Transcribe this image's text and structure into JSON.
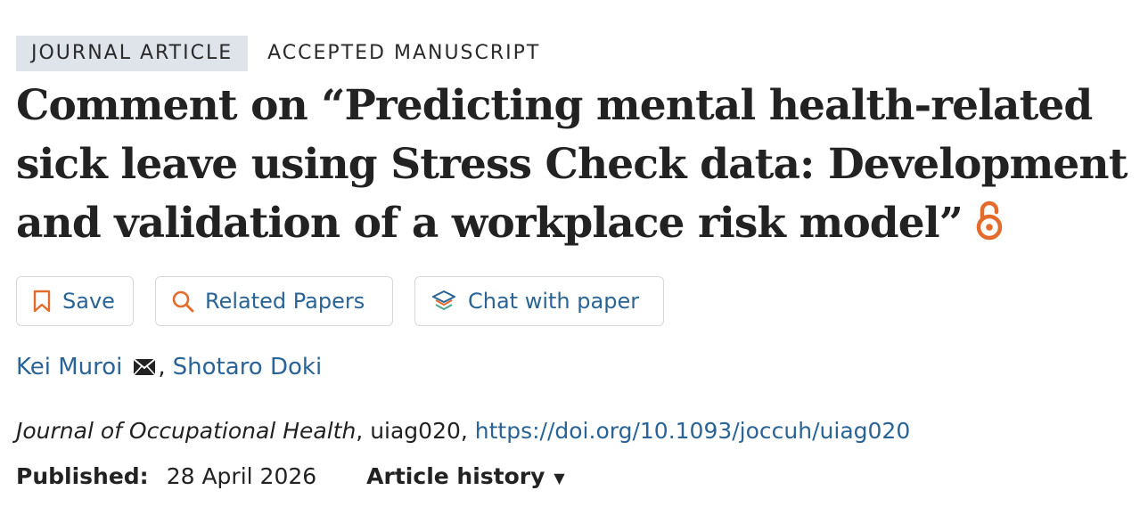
{
  "tags": {
    "type": "JOURNAL ARTICLE",
    "status": "ACCEPTED MANUSCRIPT"
  },
  "article": {
    "title": "Comment on “Predicting mental health-related sick leave using Stress Check data: Development and validation of a workplace risk model”",
    "open_access_icon": "open-access-lock-icon"
  },
  "actions": {
    "save": {
      "label": "Save",
      "icon": "bookmark-icon"
    },
    "related": {
      "label": "Related Papers",
      "icon": "search-icon"
    },
    "chat": {
      "label": "Chat with paper",
      "icon": "layers-icon"
    }
  },
  "authors": [
    {
      "name": "Kei Muroi",
      "icon": "envelope-icon"
    },
    {
      "name": "Shotaro Doki"
    }
  ],
  "author_separator": ",",
  "citation": {
    "journal": "Journal of Occupational Health",
    "after_journal": ", uiag020, ",
    "doi": "https://doi.org/10.1093/joccuh/uiag020"
  },
  "published": {
    "label": "Published:",
    "date": "28 April 2026"
  },
  "history": {
    "label": "Article history",
    "caret": "▼"
  },
  "colors": {
    "link": "#2a6496",
    "accent_orange": "#e36c2d",
    "tag_background": "#dfe3ea",
    "text": "#222222"
  }
}
